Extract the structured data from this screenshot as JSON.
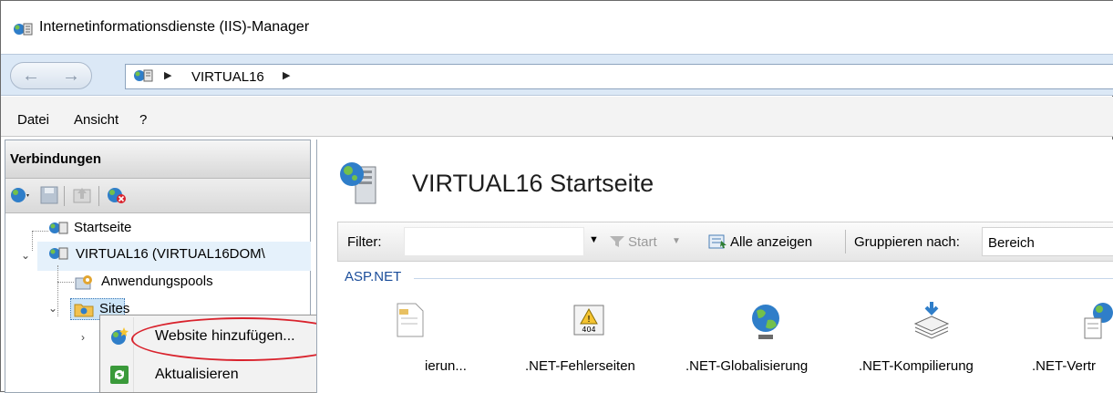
{
  "window": {
    "title": "Internetinformationsdienste (IIS)-Manager"
  },
  "address": {
    "crumbs": [
      "VIRTUAL16"
    ]
  },
  "menu": {
    "items": [
      "Datei",
      "Ansicht",
      "?"
    ]
  },
  "connections": {
    "header": "Verbindungen",
    "tree": {
      "startseite": "Startseite",
      "server": "VIRTUAL16 (VIRTUAL16DOM\\",
      "apppools": "Anwendungspools",
      "sites": "Sites"
    }
  },
  "context_menu": {
    "items": [
      {
        "label": "Website hinzufügen...",
        "icon": "globe-add-icon"
      },
      {
        "label": "Aktualisieren",
        "icon": "refresh-icon"
      }
    ]
  },
  "main": {
    "title": "VIRTUAL16 Startseite",
    "filter": {
      "label": "Filter:",
      "value": "",
      "start": "Start",
      "show_all": "Alle anzeigen",
      "group_by_label": "Gruppieren nach:",
      "group_by_value": "Bereich"
    },
    "group": "ASP.NET",
    "features": [
      {
        "label": "ierun...",
        "icon": "asp-net-document-icon"
      },
      {
        "label": ".NET-Fehlerseiten",
        "icon": "error-404-icon"
      },
      {
        "label": ".NET-Globalisierung",
        "icon": "globe-icon"
      },
      {
        "label": ".NET-Kompilierung",
        "icon": "stack-compile-icon"
      },
      {
        "label": ".NET-Vertr",
        "icon": "trust-icon"
      }
    ]
  },
  "colors": {
    "accent": "#1b4d9a",
    "address_bg": "#dbe8f6",
    "highlight_ring": "#d9232d"
  }
}
